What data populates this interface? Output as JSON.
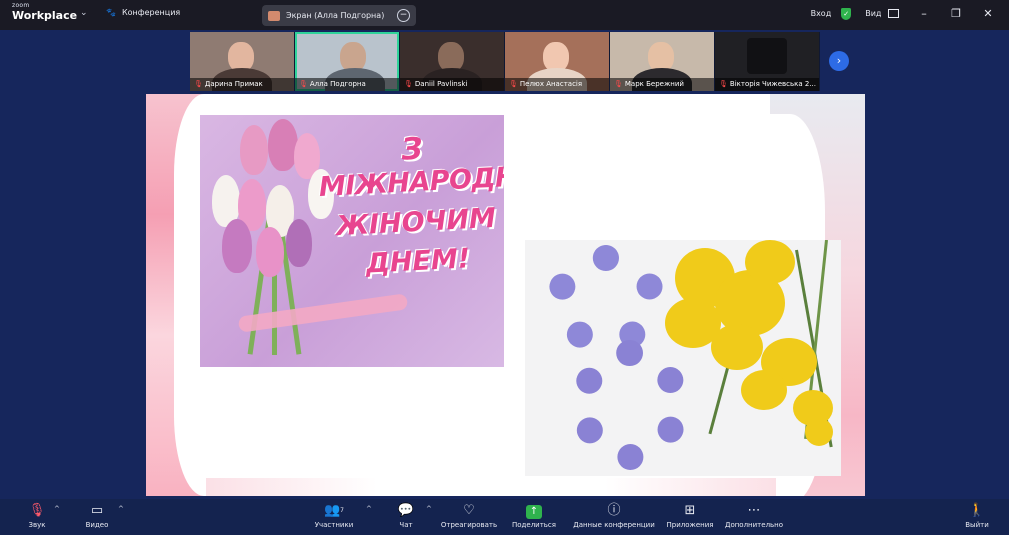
{
  "app": {
    "logo_top": "zoom",
    "logo_bottom": "Workplace",
    "meeting_menu_label": "Конференция",
    "share_pill_label": "Экран (Алла Подгорна)"
  },
  "topbar_right": {
    "login_label": "Вход",
    "view_label": "Вид"
  },
  "participants": [
    {
      "name": "Дарина Примак",
      "active": false
    },
    {
      "name": "Алла Подгорна",
      "active": true
    },
    {
      "name": "Daniil Pavlinski",
      "active": false
    },
    {
      "name": "Пелюх Анастасія",
      "active": false
    },
    {
      "name": "Марк Бережний",
      "active": false
    },
    {
      "name": "Вікторія Чижевська 2...",
      "active": false
    }
  ],
  "slide": {
    "greeting_line1": "З",
    "greeting_line2": "МІЖНАРОДНИМ",
    "greeting_line3": "ЖІНОЧИМ",
    "greeting_line4": "ДНЕМ!"
  },
  "toolbar": {
    "audio": "Звук",
    "video": "Видео",
    "participants": "Участники",
    "participants_count": "7",
    "chat": "Чат",
    "react": "Отреагировать",
    "share": "Поделиться",
    "info": "Данные конференции",
    "apps": "Приложения",
    "more": "Дополнительно",
    "leave": "Выйти"
  },
  "colors": {
    "accent_active_tile": "#2fd39a",
    "share_green": "#2fb34d",
    "gallery_next": "#2d6be6",
    "greeting_pink": "#e8458f"
  }
}
